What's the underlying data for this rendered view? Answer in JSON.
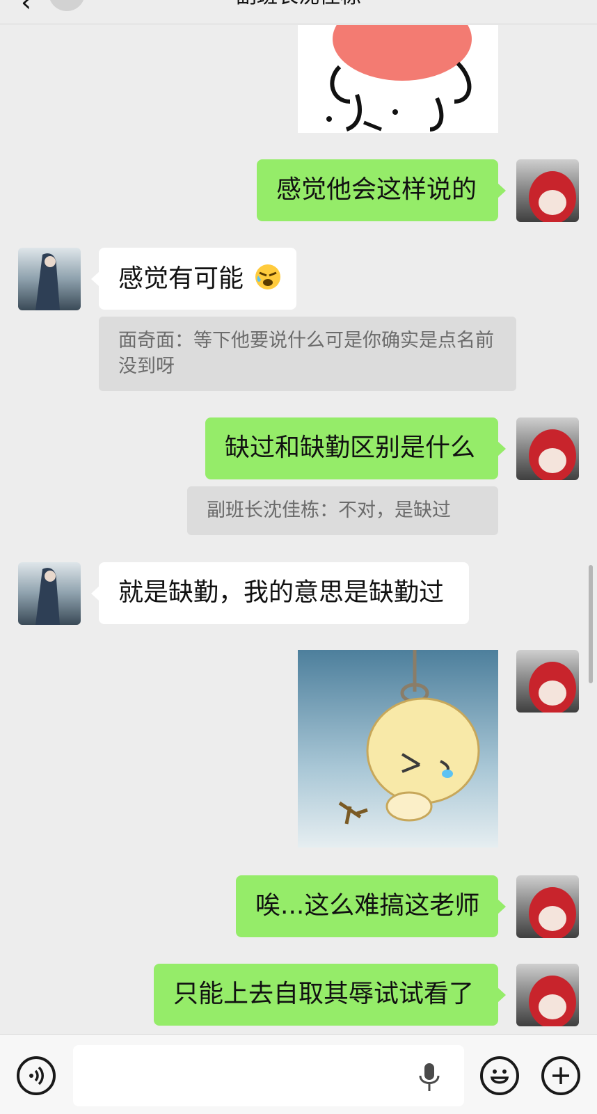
{
  "header": {
    "back_glyph": "‹",
    "title": "副班长沈佳栋"
  },
  "messages": {
    "m1": {
      "sender": "me",
      "text": "感觉他会这样说的"
    },
    "m2": {
      "sender": "other",
      "text": "感觉有可能",
      "emoji": "facepalm-cry-emoji"
    },
    "m2_quote": "面奇面：等下他要说什么可是你确实是点名前没到呀",
    "m3": {
      "sender": "me",
      "text": "缺过和缺勤区别是什么"
    },
    "m3_quote": "副班长沈佳栋：不对，是缺过",
    "m4": {
      "sender": "other",
      "text": "就是缺勤，我的意思是缺勤过"
    },
    "m5": {
      "sender": "me",
      "sticker": "hanging-cartoon-sticker"
    },
    "m6": {
      "sender": "me",
      "text": "唉...这么难搞这老师"
    },
    "m7": {
      "sender": "me",
      "text": "只能上去自取其辱试试看了"
    }
  },
  "stickers": {
    "top": "pink-blob-cartoon-sticker"
  },
  "input_bar": {
    "voice_icon": "voice-icon",
    "message_value": "",
    "mic_icon": "mic-icon",
    "emoji_icon": "emoji-icon",
    "plus_icon": "plus-icon"
  },
  "colors": {
    "background": "#ededed",
    "my_bubble": "#95ec69",
    "other_bubble": "#ffffff",
    "quote_bg": "#dcdcdc"
  }
}
